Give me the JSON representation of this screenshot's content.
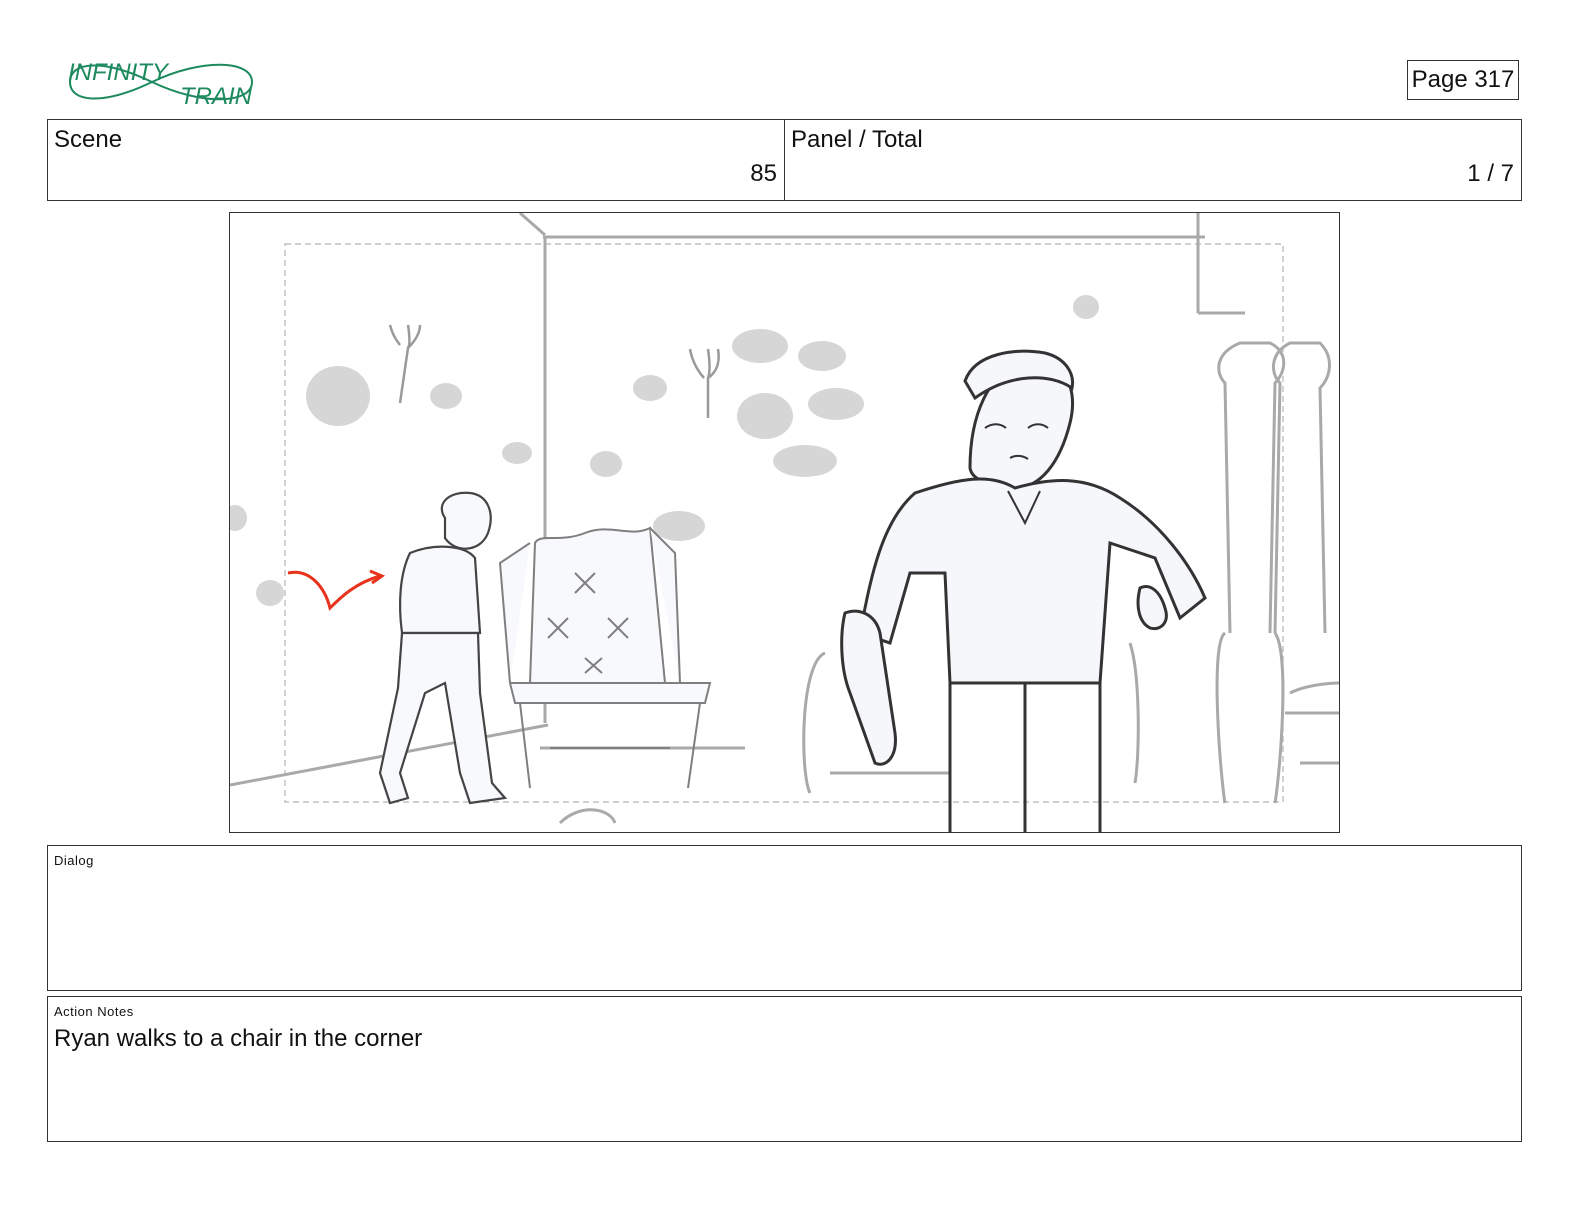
{
  "logo": {
    "line1": "INFINITY",
    "line2": "TRAIN",
    "color": "#1e8a5e"
  },
  "page": {
    "label": "Page 317"
  },
  "header": {
    "scene_label": "Scene",
    "scene_value": "85",
    "panel_label": "Panel / Total",
    "panel_value": "1 / 7"
  },
  "panel": {
    "accent_color": "#e8321c"
  },
  "dialog": {
    "label": "Dialog",
    "text": ""
  },
  "action_notes": {
    "label": "Action Notes",
    "text": "Ryan walks to a chair in the corner"
  }
}
